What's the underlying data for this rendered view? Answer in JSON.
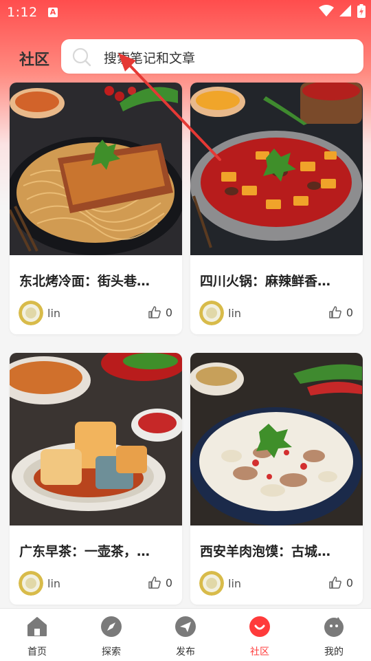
{
  "status_bar": {
    "time": "1:12",
    "notif_glyph": "A"
  },
  "header": {
    "title": "社区",
    "search_placeholder": "搜索笔记和文章"
  },
  "posts": [
    {
      "title": "东北烤冷面：街头巷…",
      "author": "lin",
      "likes": "0"
    },
    {
      "title": "四川火锅：麻辣鲜香…",
      "author": "lin",
      "likes": "0"
    },
    {
      "title": "广东早茶：一壶茶，…",
      "author": "lin",
      "likes": "0"
    },
    {
      "title": "西安羊肉泡馍：古城…",
      "author": "lin",
      "likes": "0"
    }
  ],
  "nav": [
    {
      "label": "首页",
      "icon": "home-icon"
    },
    {
      "label": "探索",
      "icon": "compass-icon"
    },
    {
      "label": "发布",
      "icon": "send-icon"
    },
    {
      "label": "社区",
      "icon": "community-icon",
      "active": true
    },
    {
      "label": "我的",
      "icon": "profile-icon"
    }
  ],
  "colors": {
    "accent": "#ff3b3b",
    "nav_icon": "#7a7a7a"
  }
}
